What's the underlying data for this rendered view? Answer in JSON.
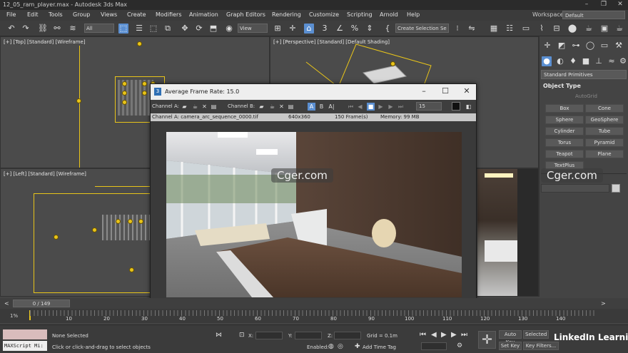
{
  "window": {
    "title": "12_05_ram_player.max - Autodesk 3ds Max"
  },
  "menu": {
    "items": [
      "File",
      "Edit",
      "Tools",
      "Group",
      "Views",
      "Create",
      "Modifiers",
      "Animation",
      "Graph Editors",
      "Rendering",
      "Customize",
      "Scripting",
      "Arnold",
      "Help"
    ],
    "workspaces_label": "Workspaces:",
    "workspaces_value": "Default"
  },
  "toolbar": {
    "filter_value": "All",
    "refcoord_value": "View",
    "selection_set_placeholder": "Create Selection Se"
  },
  "viewports": {
    "top": "[+] [Top] [Standard] [Wireframe]",
    "perspective": "[+] [Perspective] [Standard] [Default Shading]",
    "left": "[+] [Left] [Standard] [Wireframe]"
  },
  "command_panel": {
    "dropdown": "Standard Primitives",
    "rollout_title": "Object Type",
    "autogrid": "AutoGrid",
    "buttons": [
      "Box",
      "Cone",
      "Sphere",
      "GeoSphere",
      "Cylinder",
      "Tube",
      "Torus",
      "Pyramid",
      "Teapot",
      "Plane",
      "TextPlus"
    ]
  },
  "ram_player": {
    "title": "Average Frame Rate: 15.0",
    "channel_a_label": "Channel A:",
    "channel_b_label": "Channel B:",
    "btn_a": "A",
    "btn_b": "B",
    "fps_value": "15",
    "info_file": "Channel A: camera_arc_sequence_0000.tif",
    "info_res": "640x360",
    "info_frames": "150 Frame(s)",
    "info_memory": "Memory: 99 MB"
  },
  "timeline": {
    "frame_counter": "0 / 149",
    "ticks": [
      "10",
      "20",
      "30",
      "40",
      "50",
      "60",
      "70",
      "80",
      "90",
      "100",
      "110",
      "120",
      "130",
      "140"
    ],
    "percent": "1%"
  },
  "status": {
    "selection": "None Selected",
    "prompt": "Click or click-and-drag to select objects",
    "maxscript": "MAXScript Mi:",
    "x_label": "X:",
    "y_label": "Y:",
    "z_label": "Z:",
    "grid": "Grid = 0.1m",
    "enabled": "Enabled:",
    "add_time_tag": "Add Time Tag",
    "auto_key": "Auto Key",
    "selected": "Selected",
    "set_key": "Set Key",
    "key_filters": "Key Filters..."
  },
  "watermarks": {
    "text": "Cger.com",
    "brand": "LinkedIn Learning"
  },
  "colors": {
    "accent": "#5b8fd1",
    "wire": "#e8c41a",
    "bg": "#444444"
  }
}
